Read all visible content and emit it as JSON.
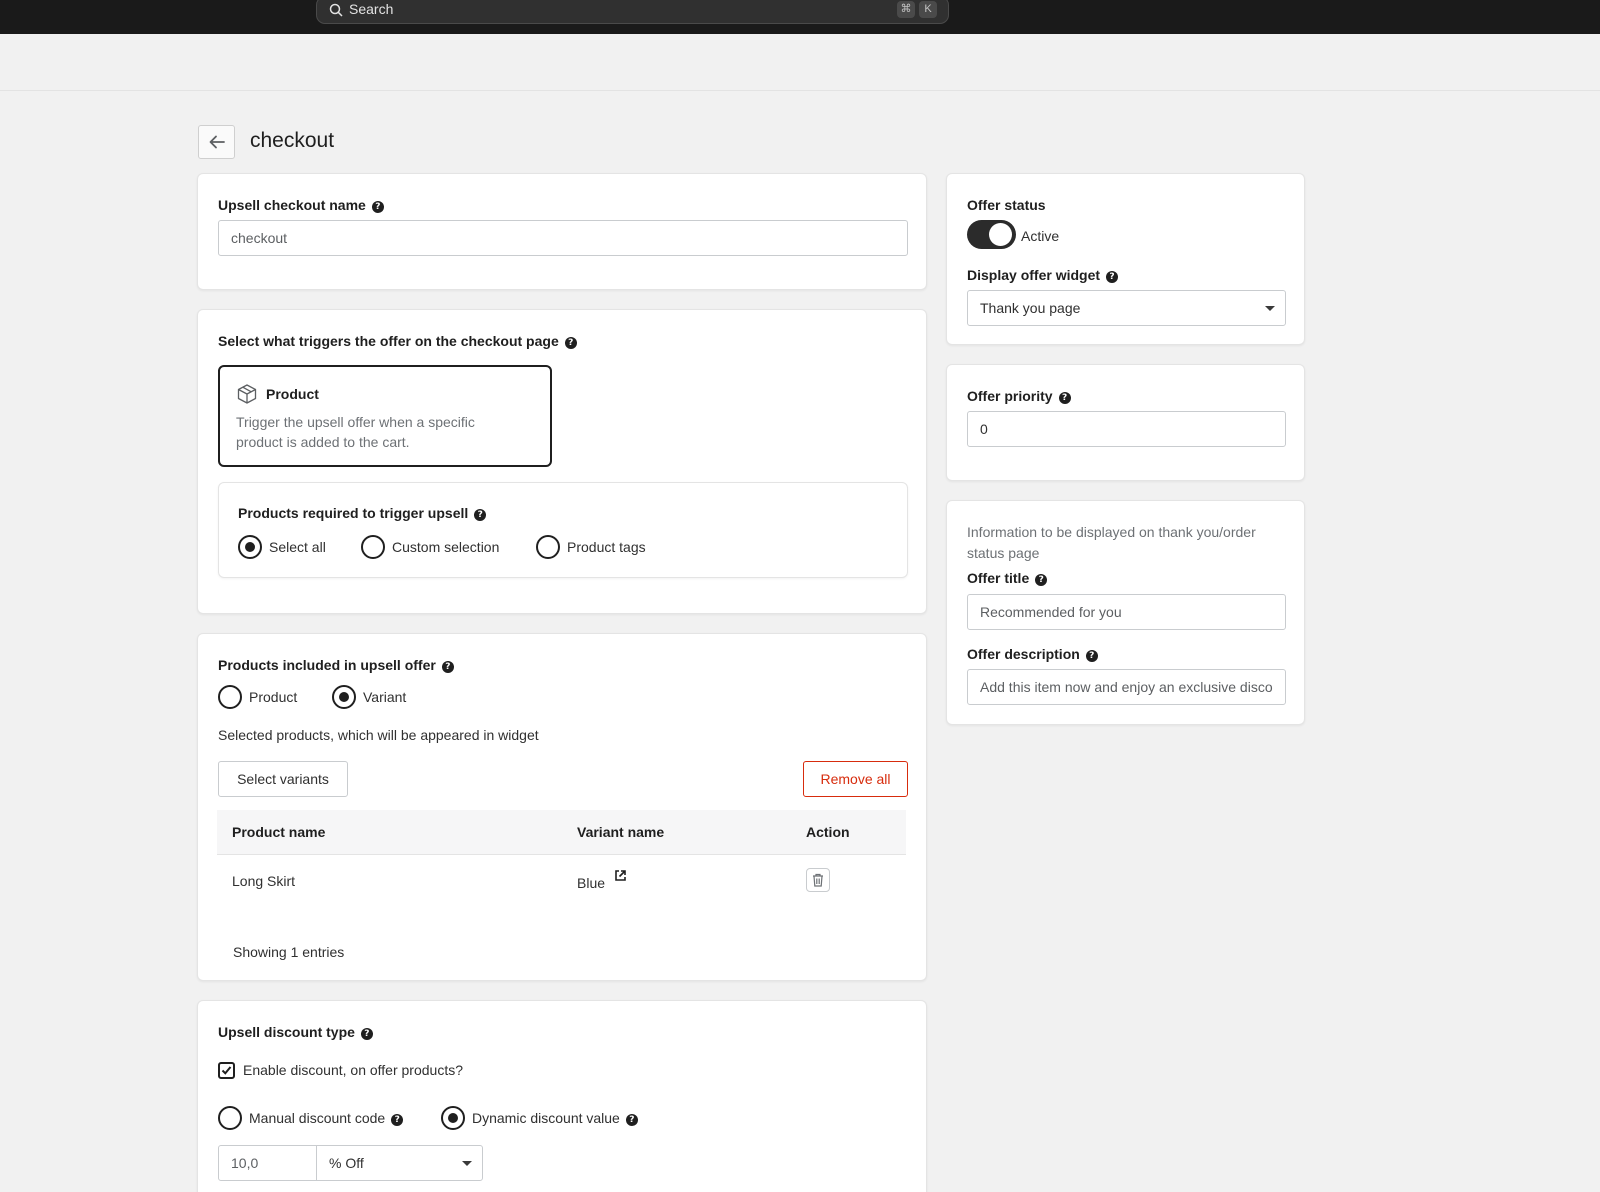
{
  "topbar": {
    "search_placeholder": "Search",
    "shortcut_cmd": "⌘",
    "shortcut_key": "K"
  },
  "page": {
    "title": "checkout"
  },
  "name_card": {
    "label": "Upsell checkout name",
    "value": "checkout"
  },
  "trigger_card": {
    "heading": "Select what triggers the offer on the checkout page",
    "option_title": "Product",
    "option_description": "Trigger the upsell offer when a specific product is added to the cart.",
    "required_label": "Products required to trigger upsell",
    "radios": [
      {
        "label": "Select all",
        "checked": true
      },
      {
        "label": "Custom selection",
        "checked": false
      },
      {
        "label": "Product tags",
        "checked": false
      }
    ]
  },
  "included_card": {
    "heading": "Products included in upsell offer",
    "radios": [
      {
        "label": "Product",
        "checked": false
      },
      {
        "label": "Variant",
        "checked": true
      }
    ],
    "selected_text": "Selected products, which will be appeared in widget",
    "select_button": "Select variants",
    "remove_button": "Remove all",
    "table": {
      "headers": [
        "Product name",
        "Variant name",
        "Action"
      ],
      "rows": [
        {
          "product": "Long Skirt",
          "variant": "Blue"
        }
      ]
    },
    "footer": "Showing 1 entries"
  },
  "discount_card": {
    "heading": "Upsell discount type",
    "checkbox_label": "Enable discount, on offer products?",
    "checkbox_checked": true,
    "radios": [
      {
        "label": "Manual discount code",
        "checked": false
      },
      {
        "label": "Dynamic discount value",
        "checked": true
      }
    ],
    "amount": "10,0",
    "unit": "% Off"
  },
  "status_card": {
    "status_label": "Offer status",
    "toggle_text": "Active",
    "toggle_on": true,
    "widget_label": "Display offer widget",
    "widget_value": "Thank you page"
  },
  "priority_card": {
    "label": "Offer priority",
    "value": "0"
  },
  "info_card": {
    "intro": "Information to be displayed on thank you/order status page",
    "title_label": "Offer title",
    "title_value": "Recommended for you",
    "desc_label": "Offer description",
    "desc_value": "Add this item now and enjoy an exclusive disco"
  },
  "colors": {
    "topbar": "#1a1a1a",
    "background": "#f1f1f1",
    "danger": "#d72c0d"
  }
}
